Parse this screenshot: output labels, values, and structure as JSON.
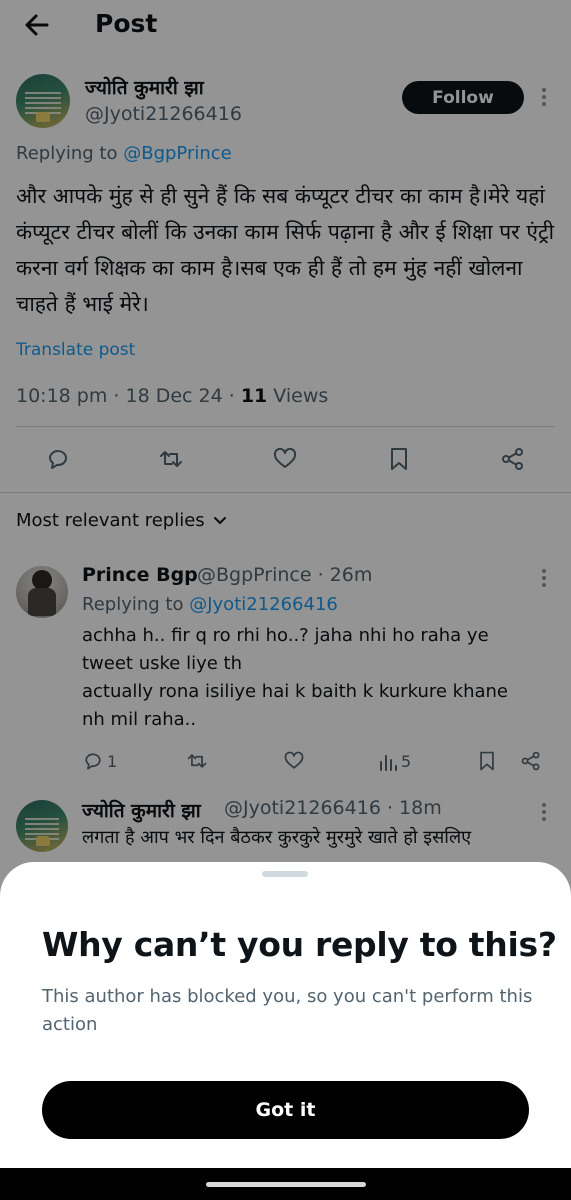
{
  "header": {
    "title": "Post",
    "back_icon": "arrow-left-icon"
  },
  "post": {
    "author_name": "ज्योति कुमारी झा",
    "author_handle": "@Jyoti21266416",
    "follow_label": "Follow",
    "replying_prefix": "Replying to",
    "replying_to": "@BgpPrince",
    "body": "और आपके मुंह से ही सुने हैं कि सब कंप्यूटर टीचर का काम है।मेरे यहां कंप्यूटर टीचर बोलीं कि उनका काम सिर्फ पढ़ाना है और ई शिक्षा पर एंट्री करना वर्ग शिक्षक का काम है।सब एक ही हैं तो हम मुंह नहीं खोलना चाहते हैं भाई मेरे।",
    "translate_label": "Translate post",
    "time": "10:18 pm · 18 Dec 24 · ",
    "views_count": "11",
    "views_label": " Views"
  },
  "sort_label": "Most relevant replies",
  "replies": [
    {
      "name": "Prince Bgp",
      "handle_time": "@BgpPrince · 26m",
      "replying_prefix": "Replying to",
      "replying_to": "@Jyoti21266416",
      "text_line1": "achha h.. fir q ro rhi ho..? jaha nhi ho raha ye",
      "text_line2": "tweet uske liye th",
      "text_line3": "actually rona isiliye hai k baith k kurkure khane",
      "text_line4": "nh mil raha..",
      "reply_count": "1",
      "views_count": "5"
    },
    {
      "name": "ज्योति कुमारी झा",
      "handle_time": "@Jyoti21266416 · 18m",
      "text_line1": "लगता है आप भर दिन बैठकर कुरकुरे मुरमुरे खाते हो इसलिए"
    }
  ],
  "sheet": {
    "title": "Why can’t you reply to this?",
    "message": "This author has blocked you, so you can't perform this action",
    "button_label": "Got it"
  },
  "colors": {
    "link": "#1d9bf0",
    "secondary_text": "#536471",
    "button_dark": "#0f1419"
  }
}
